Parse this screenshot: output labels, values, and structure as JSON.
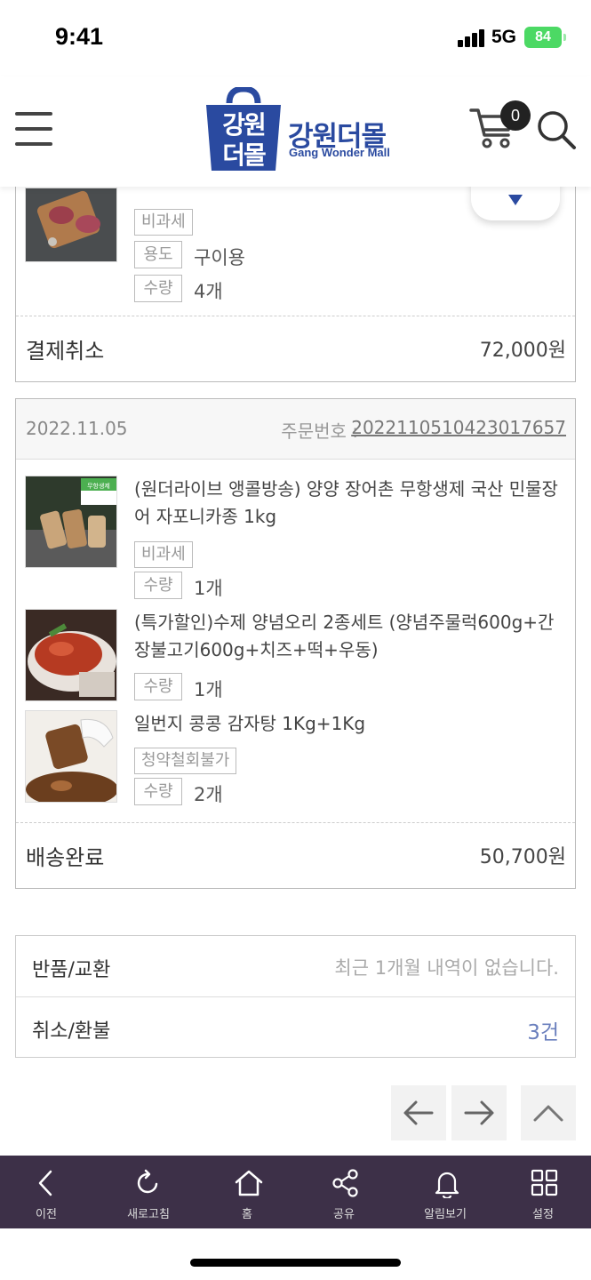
{
  "status_bar": {
    "time": "9:41",
    "network": "5G",
    "battery": "84"
  },
  "header": {
    "logo_mark": "강원더몰",
    "logo_korean": "강원더몰",
    "logo_english": "Gang Wonder Mall",
    "cart_count": "0",
    "icons": [
      "menu-icon",
      "cart-icon",
      "search-icon"
    ]
  },
  "orders": [
    {
      "partial_title": "...",
      "items": [
        {
          "tag": "비과세",
          "use_label": "용도",
          "use_value": "구이용",
          "qty_label": "수량",
          "qty": "4개"
        }
      ],
      "status": "결제취소",
      "total": "72,000원"
    },
    {
      "date": "2022.11.05",
      "order_no_label": "주문번호 :",
      "order_no": "2022110510423017657",
      "items": [
        {
          "title": "(원더라이브 앵콜방송) 양양 장어촌 무항생제 국산 민물장어 자포니카종 1kg",
          "tag": "비과세",
          "thumb_badge": "무항생제",
          "qty_label": "수량",
          "qty": "1개"
        },
        {
          "title": "(특가할인)수제 양념오리 2종세트 (양념주물럭600g+간장불고기600g+치즈+떡+우동)",
          "qty_label": "수량",
          "qty": "1개"
        },
        {
          "title": "일번지 콩콩 감자탕 1Kg+1Kg",
          "tag": "청약철회불가",
          "qty_label": "수량",
          "qty": "2개"
        }
      ],
      "status": "배송완료",
      "total": "50,700원"
    }
  ],
  "summary": {
    "returns_label": "반품/교환",
    "returns_value": "최근 1개월 내역이 없습니다.",
    "cancels_label": "취소/환불",
    "cancels_value": "3건"
  },
  "toolbar": {
    "back": "이전",
    "refresh": "새로고침",
    "home": "홈",
    "share": "공유",
    "alerts": "알림보기",
    "settings": "설정"
  },
  "colors": {
    "brand_blue": "#2a4aa0",
    "toolbar_bg": "#3d3048",
    "battery_green": "#4cd964",
    "count_blue": "#6a7fbd"
  }
}
